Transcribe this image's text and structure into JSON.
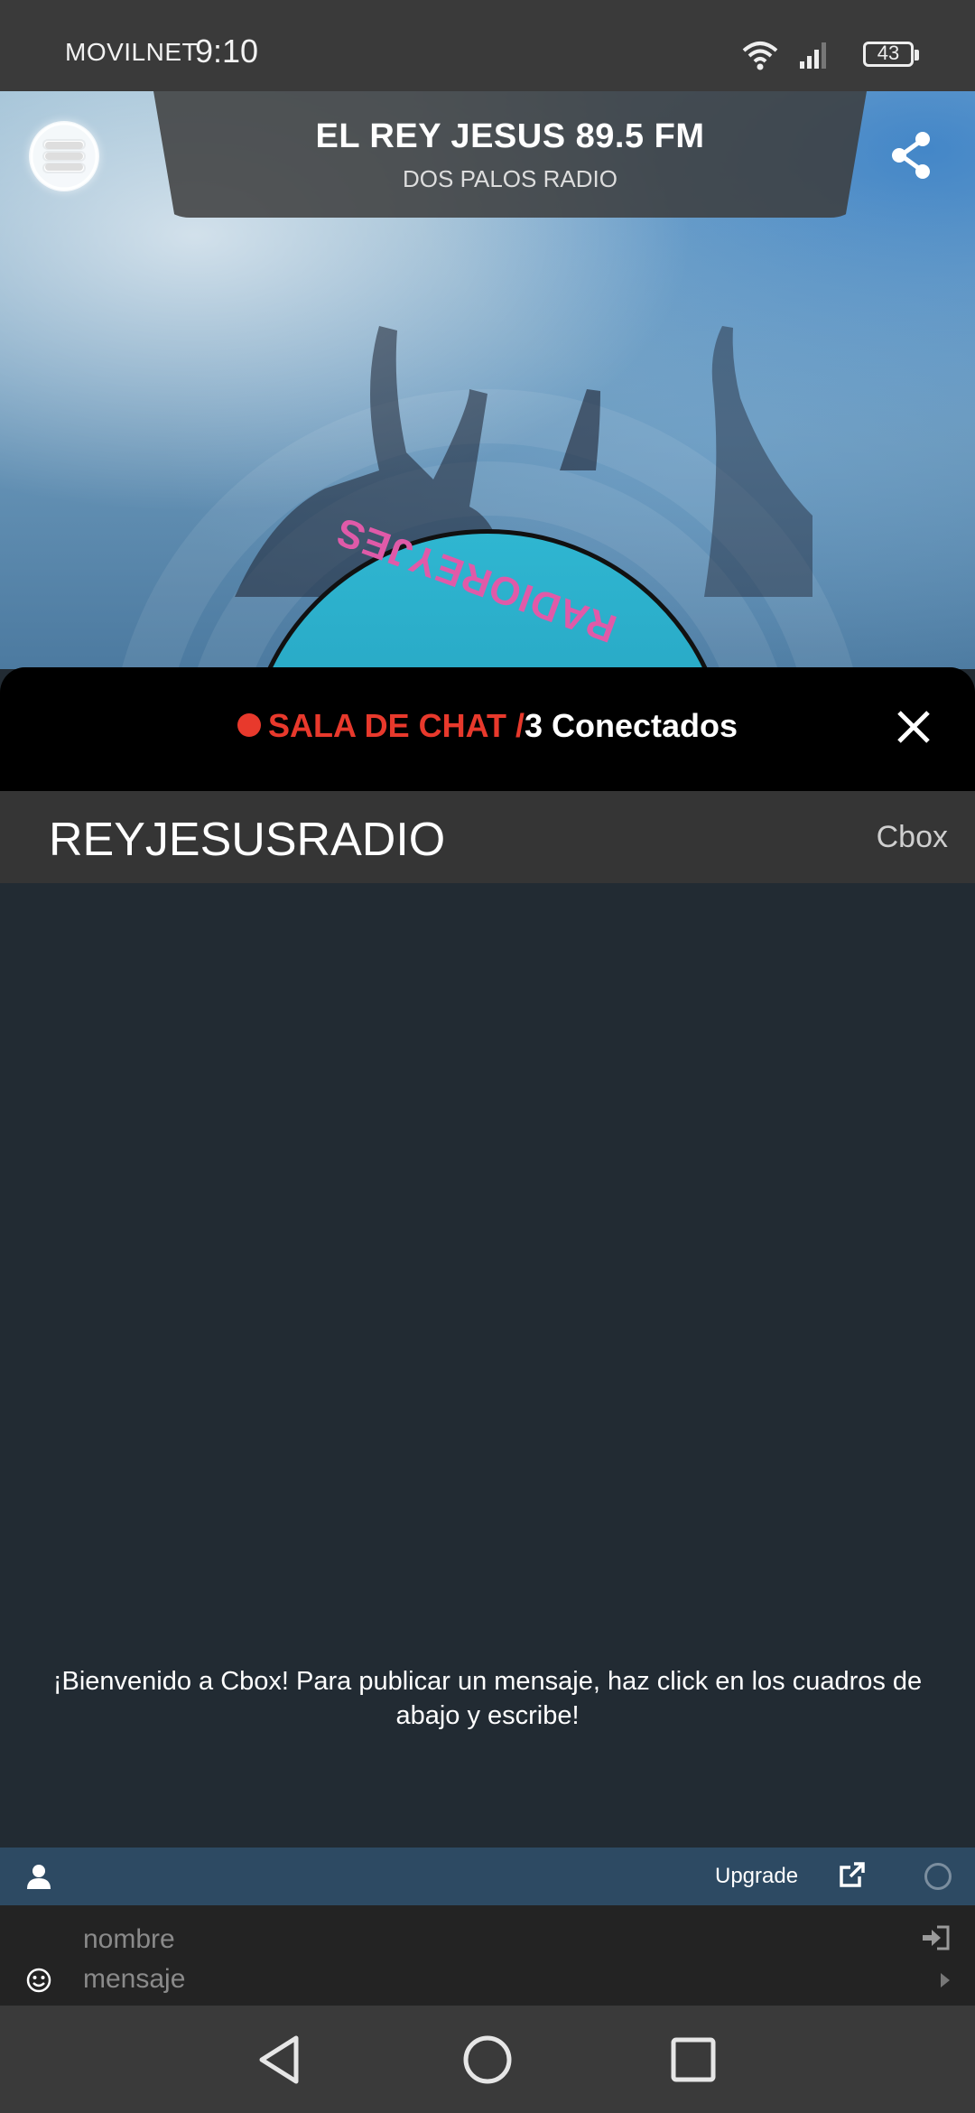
{
  "status_bar": {
    "carrier": "MOVILNET",
    "time": "9:10",
    "battery": "43"
  },
  "station": {
    "name": "EL REY JESUS 89.5 FM",
    "subtitle": "DOS PALOS RADIO",
    "artwork_text": "RADIOREYJES"
  },
  "chat": {
    "label": "SALA DE CHAT /",
    "connected": "3 Conectados",
    "room_name": "REYJESUSRADIO",
    "provider_link": "Cbox",
    "welcome": "¡Bienvenido a Cbox! Para publicar un mensaje, haz click en los cuadros de abajo y escribe!",
    "upgrade_label": "Upgrade",
    "name_placeholder": "nombre",
    "message_placeholder": "mensaje"
  },
  "colors": {
    "accent_red": "#e8392c",
    "chat_bg": "#222b33",
    "toolbar": "#2d4a63"
  }
}
